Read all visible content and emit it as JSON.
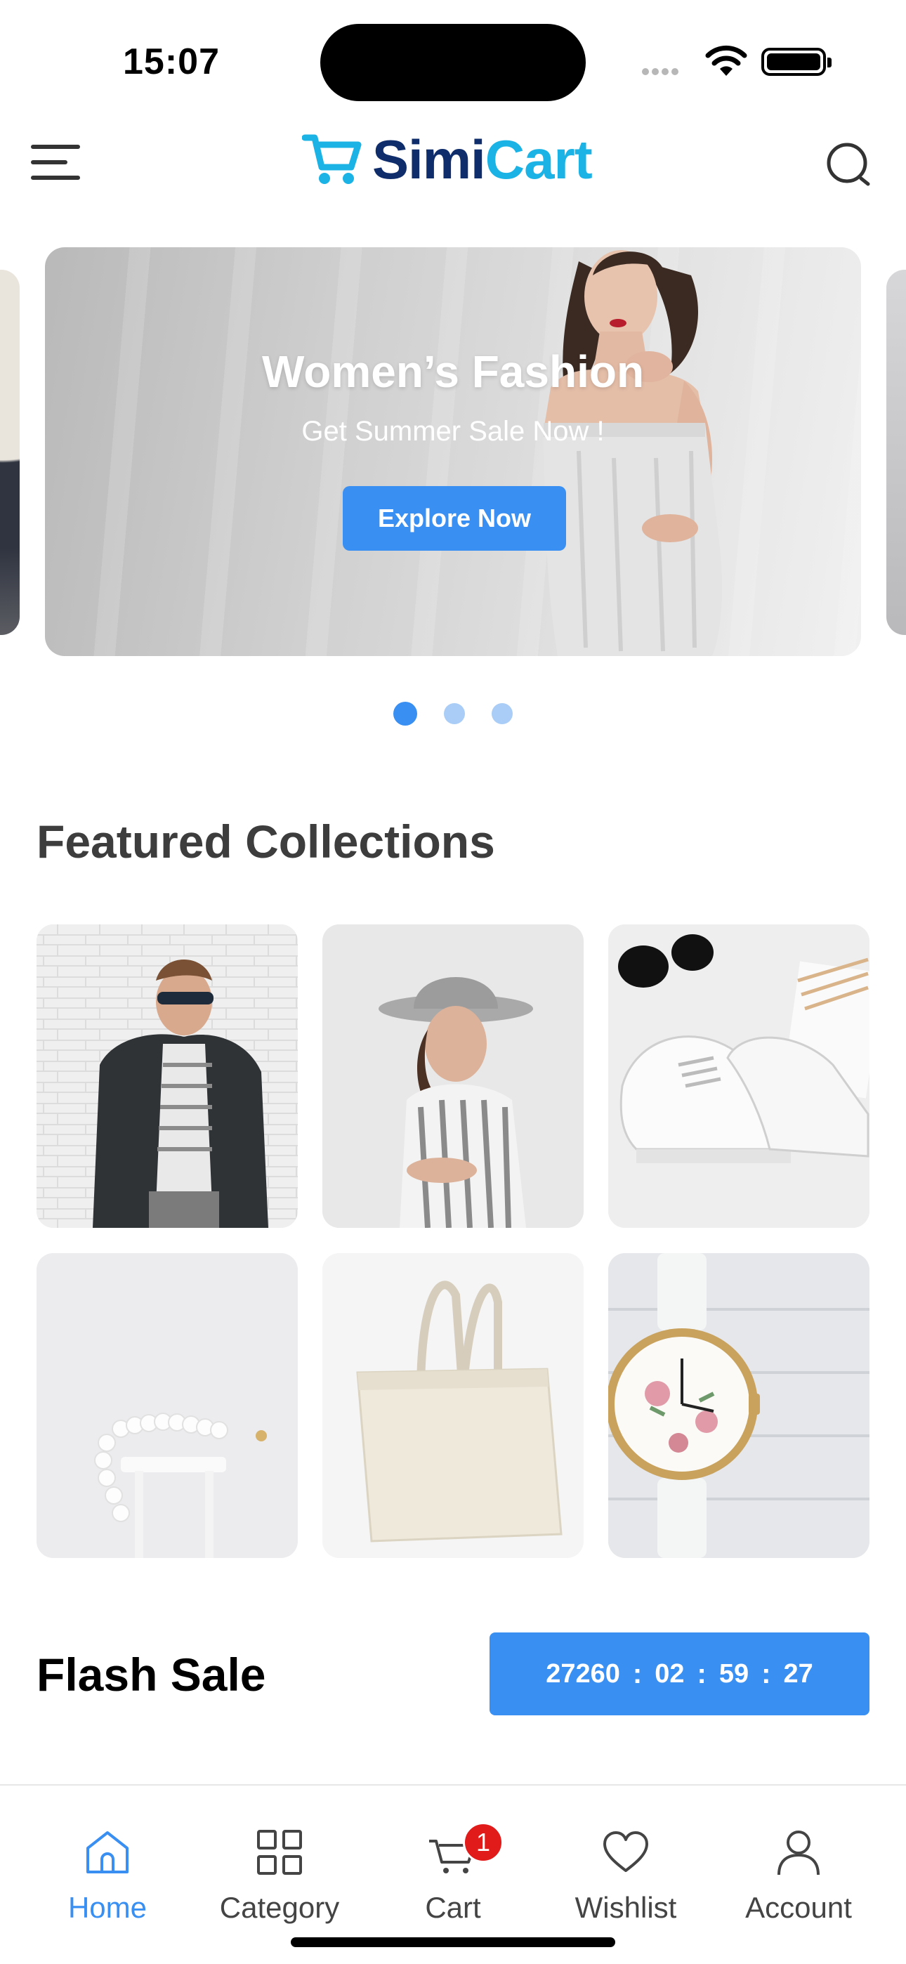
{
  "status_bar": {
    "time": "15:07"
  },
  "header": {
    "logo_part1": "Simi",
    "logo_part2": "Cart",
    "menu_icon": "hamburger-menu-icon",
    "search_icon": "search-icon"
  },
  "banner": {
    "title": "Women’s Fashion",
    "subtitle": "Get Summer Sale Now !",
    "button_label": "Explore Now",
    "slides_count": 3,
    "active_slide": 1
  },
  "featured": {
    "title": "Featured Collections",
    "items": [
      {
        "image": "man-in-blazer-photo"
      },
      {
        "image": "woman-in-hat-photo"
      },
      {
        "image": "white-sneakers-photo"
      },
      {
        "image": "pearl-bracelets-photo"
      },
      {
        "image": "canvas-tote-bag-photo"
      },
      {
        "image": "floral-wristwatch-photo"
      }
    ]
  },
  "flash_sale": {
    "title": "Flash Sale",
    "countdown": {
      "days": "27260",
      "hours": "02",
      "minutes": "59",
      "seconds": "27",
      "separator": ":"
    }
  },
  "tabbar": {
    "items": [
      {
        "label": "Home",
        "icon": "home-icon",
        "active": true
      },
      {
        "label": "Category",
        "icon": "category-grid-icon",
        "active": false
      },
      {
        "label": "Cart",
        "icon": "cart-icon",
        "active": false,
        "badge": "1"
      },
      {
        "label": "Wishlist",
        "icon": "heart-icon",
        "active": false
      },
      {
        "label": "Account",
        "icon": "user-icon",
        "active": false
      }
    ]
  },
  "colors": {
    "accent": "#3a8ff2",
    "badge": "#e11a1a",
    "logo_dark": "#0f2c6b",
    "logo_light": "#1bb3e6"
  }
}
